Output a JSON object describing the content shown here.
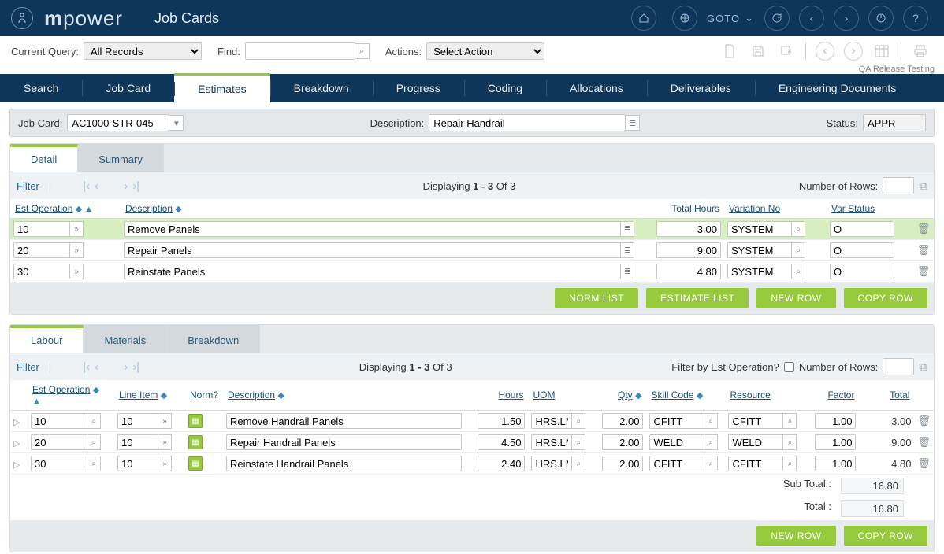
{
  "brand": {
    "m": "m",
    "rest": "power"
  },
  "page_title": "Job Cards",
  "goto_label": "GOTO",
  "qa_note": "QA Release Testing",
  "toolbar": {
    "current_query_label": "Current Query:",
    "current_query_value": "All Records",
    "find_label": "Find:",
    "find_value": "",
    "actions_label": "Actions:",
    "actions_value": "Select Action"
  },
  "main_tabs": [
    "Search",
    "Job Card",
    "Estimates",
    "Breakdown",
    "Progress",
    "Coding",
    "Allocations",
    "Deliverables",
    "Engineering Documents"
  ],
  "main_tab_active": 2,
  "header": {
    "jobcard_label": "Job Card:",
    "jobcard_value": "AC1000-STR-045",
    "description_label": "Description:",
    "description_value": "Repair Handrail",
    "status_label": "Status:",
    "status_value": "APPR"
  },
  "upper": {
    "tabs": [
      "Detail",
      "Summary"
    ],
    "active": 0,
    "filter_label": "Filter",
    "display_text_prefix": "Displaying ",
    "display_bold": "1 - 3",
    "display_suffix": " Of 3",
    "rows_label": "Number of Rows:",
    "columns": {
      "est_op": "Est Operation",
      "description": "Description",
      "total_hours": "Total Hours",
      "var_no": "Variation No",
      "var_status": "Var Status"
    },
    "rows": [
      {
        "op": "10",
        "desc": "Remove Panels",
        "hours": "3.00",
        "varno": "SYSTEM",
        "varstatus": "O"
      },
      {
        "op": "20",
        "desc": "Repair Panels",
        "hours": "9.00",
        "varno": "SYSTEM",
        "varstatus": "O"
      },
      {
        "op": "30",
        "desc": "Reinstate Panels",
        "hours": "4.80",
        "varno": "SYSTEM",
        "varstatus": "O"
      }
    ],
    "buttons": {
      "norm": "NORM LIST",
      "estimate": "ESTIMATE LIST",
      "newrow": "NEW ROW",
      "copyrow": "COPY ROW"
    }
  },
  "lower": {
    "tabs": [
      "Labour",
      "Materials",
      "Breakdown"
    ],
    "active": 0,
    "filter_label": "Filter",
    "display_text_prefix": "Displaying ",
    "display_bold": "1 - 3",
    "display_suffix": " Of 3",
    "filter_by_est_label": "Filter by Est Operation?",
    "rows_label": "Number of Rows:",
    "columns": {
      "est_op": "Est Operation",
      "line_item": "Line Item",
      "norm": "Norm?",
      "description": "Description",
      "hours": "Hours",
      "uom": "UOM",
      "qty": "Qty",
      "skill": "Skill Code",
      "resource": "Resource",
      "factor": "Factor",
      "total": "Total"
    },
    "rows": [
      {
        "op": "10",
        "line": "10",
        "desc": "Remove Handrail Panels",
        "hours": "1.50",
        "uom": "HRS.LM",
        "qty": "2.00",
        "skill": "CFITT",
        "resource": "CFITT",
        "factor": "1.00",
        "total": "3.00"
      },
      {
        "op": "20",
        "line": "10",
        "desc": "Repair Handrail Panels",
        "hours": "4.50",
        "uom": "HRS.LM",
        "qty": "2.00",
        "skill": "WELD",
        "resource": "WELD",
        "factor": "1.00",
        "total": "9.00"
      },
      {
        "op": "30",
        "line": "10",
        "desc": "Reinstate Handrail Panels",
        "hours": "2.40",
        "uom": "HRS.LM",
        "qty": "2.00",
        "skill": "CFITT",
        "resource": "CFITT",
        "factor": "1.00",
        "total": "4.80"
      }
    ],
    "subtotal_label": "Sub Total :",
    "subtotal_value": "16.80",
    "total_label": "Total :",
    "total_value": "16.80",
    "buttons": {
      "newrow": "NEW ROW",
      "copyrow": "COPY ROW"
    }
  }
}
